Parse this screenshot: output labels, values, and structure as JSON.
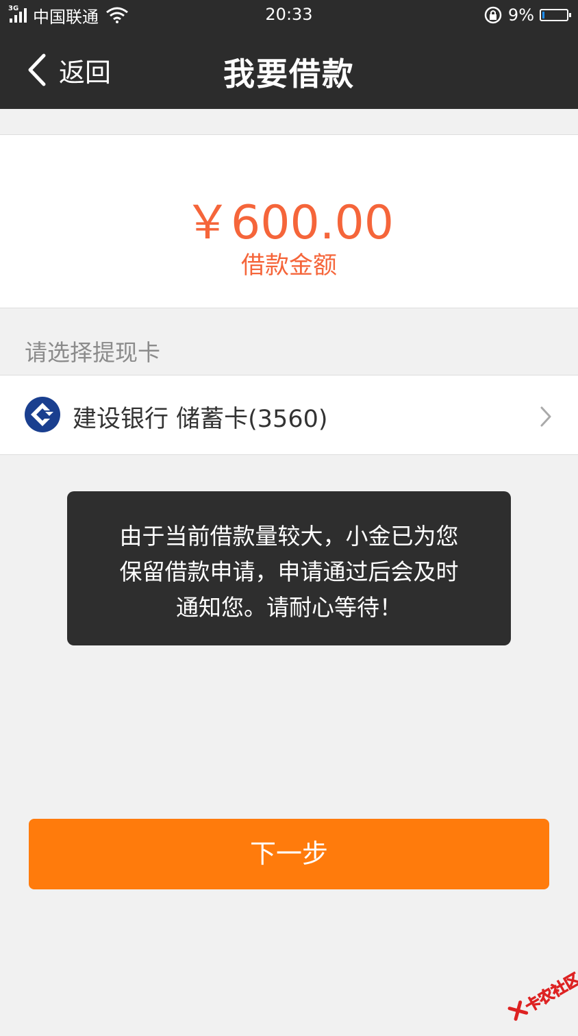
{
  "status_bar": {
    "network": "3G",
    "carrier": "中国联通",
    "time": "20:33",
    "battery": "9%",
    "battery_level": 0.09
  },
  "nav": {
    "back_label": "返回",
    "title": "我要借款"
  },
  "amount": {
    "value": "￥600.00",
    "label": "借款金额",
    "color": "#f5653a"
  },
  "withdraw": {
    "section_label": "请选择提现卡",
    "card_text": "建设银行 储蓄卡(3560)",
    "bank_logo_color": "#1a3f8f"
  },
  "toast": {
    "lines": [
      "由于当前借款量较大，小金已为您",
      "保留借款申请，申请通过后会及时",
      "通知您。请耐心等待！"
    ]
  },
  "next_button": {
    "label": "下一步",
    "color": "#ff7b0c"
  },
  "watermark": {
    "text": "卡农社区"
  }
}
